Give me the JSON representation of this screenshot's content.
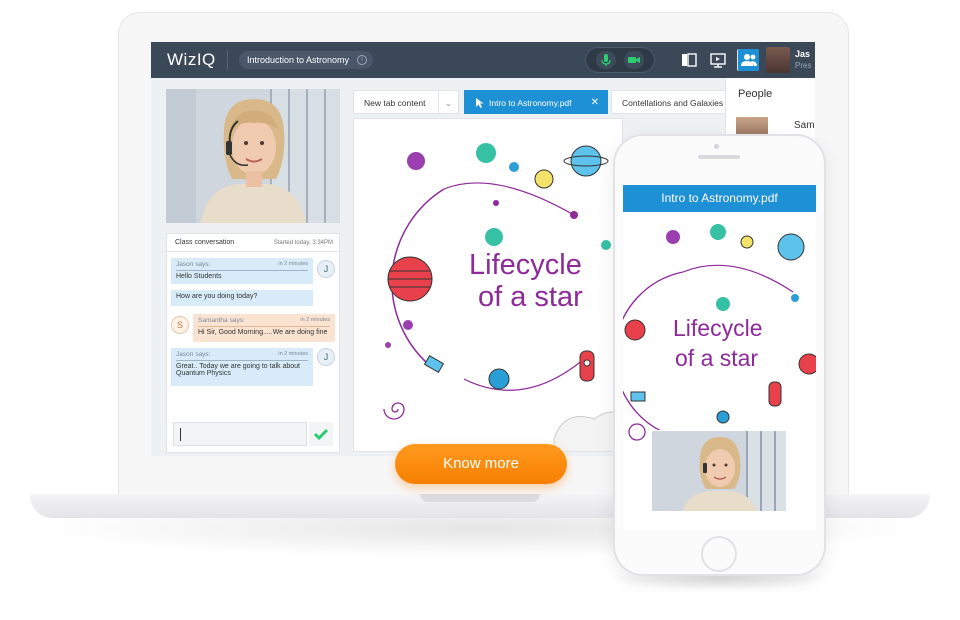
{
  "app": {
    "logo": "WizIQ",
    "course_title": "Introduction to Astronomy",
    "user_name": "Jas",
    "user_role": "Pres"
  },
  "tabs": [
    {
      "label": "New tab content"
    },
    {
      "label": "Intro to Astronomy.pdf",
      "active": true
    },
    {
      "label": "Contellations and Galaxies"
    }
  ],
  "slide": {
    "line1": "Lifecycle",
    "line2": "of a star"
  },
  "people": {
    "title": "People",
    "first_name": "Sam"
  },
  "chat": {
    "title": "Class conversation",
    "started": "Started today, 3:34PM",
    "messages": [
      {
        "author": "Jason",
        "says": "says:",
        "time": "in 2 minutes",
        "lines": [
          "Hello Students"
        ],
        "avatar": "J"
      },
      {
        "author": "",
        "lines": [
          "How are you doing today?"
        ]
      },
      {
        "author": "Samantha",
        "says": "says:",
        "time": "in 2 minutes",
        "lines": [
          "Hi Sir, Good Morning.....We are doing fine"
        ],
        "avatar": "S"
      },
      {
        "author": "Jason",
        "says": "says:",
        "time": "in 2 minutes",
        "lines": [
          "Great.. Today we are going to talk about",
          "Quantum Physics"
        ],
        "avatar": "J"
      }
    ]
  },
  "cta": {
    "label": "Know more"
  },
  "phone": {
    "header": "Intro to Astronomy.pdf"
  },
  "colors": {
    "topbar": "#3b4858",
    "accent": "#1e90d6",
    "cta": "#f77f00",
    "slide_text": "#8e2a9a",
    "mic_green": "#2ecc71"
  },
  "icons": [
    "mic-icon",
    "camera-icon",
    "whiteboard-icon",
    "screen-share-icon",
    "people-icon",
    "info-icon",
    "dropdown-icon",
    "close-icon",
    "cursor-icon",
    "send-check-icon"
  ]
}
